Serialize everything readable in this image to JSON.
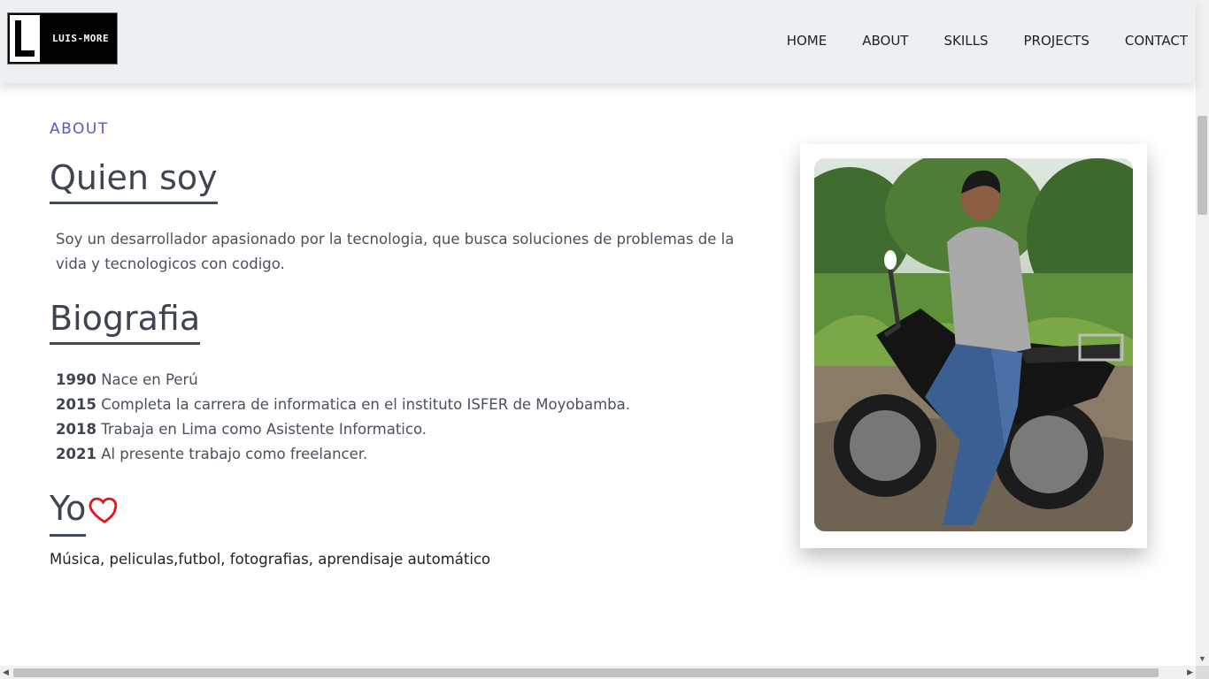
{
  "header": {
    "logo_text": "LUIS-MORE",
    "nav": [
      "HOME",
      "ABOUT",
      "SKILLS",
      "PROJECTS",
      "CONTACT"
    ]
  },
  "about": {
    "section_label": "ABOUT",
    "quien_title": "Quien soy",
    "quien_text": "Soy un desarrollador apasionado por la tecnologia, que busca soluciones de problemas de la vida y tecnologicos con codigo.",
    "bio_title": "Biografia",
    "timeline": [
      {
        "year": "1990",
        "text": "Nace en Perú"
      },
      {
        "year": "2015",
        "text": "Completa la carrera de informatica en el instituto ISFER de Moyobamba."
      },
      {
        "year": "2018",
        "text": "Trabaja en Lima como Asistente Informatico."
      },
      {
        "year": "2021",
        "text": "Al presente trabajo como freelancer."
      }
    ],
    "yo_title": "Yo",
    "hobbies": "Música, peliculas,futbol, fotografias, aprendisaje automático"
  },
  "colors": {
    "accent": "#5a57c8",
    "heart": "#e8131a",
    "header_bg": "#edf0f3"
  },
  "icons": {
    "heart": "heart-outline-icon"
  }
}
